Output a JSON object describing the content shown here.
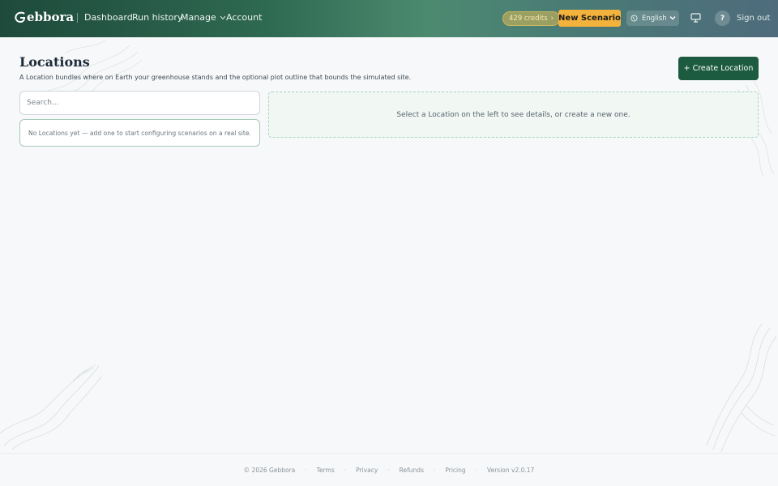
{
  "header": {
    "logo_text": "ebbora",
    "logo_letter": "G",
    "nav": {
      "dashboard": "Dashboard",
      "run_history": "Run history",
      "manage": "Manage",
      "account": "Account"
    },
    "credits": "429 credits",
    "credits_arrow": "›",
    "new_scenario": "New Scenario",
    "language": "English",
    "help": "?",
    "sign_out": "Sign out"
  },
  "main": {
    "title": "Locations",
    "subtitle": "A Location bundles where on Earth your greenhouse stands and the optional plot outline that bounds the simulated site.",
    "create_button": "+ Create Location",
    "search_placeholder": "Search...",
    "empty_message": "No Locations yet — add one to start configuring scenarios on a real site.",
    "detail_placeholder": "Select a Location on the left to see details, or create a new one."
  },
  "footer": {
    "copyright": "© 2026 Gebbora",
    "links": [
      "Terms",
      "Privacy",
      "Refunds",
      "Pricing"
    ],
    "version": "Version v2.0.17"
  },
  "colors": {
    "header_gradient_start": "#1e4a3b",
    "header_gradient_end": "#4e6b7c",
    "accent_yellow": "#f3b23b",
    "primary_green": "#1d5b40",
    "background": "#f7f8f9"
  },
  "icons": [
    "logo-icon",
    "chevron-down-icon",
    "globe-icon",
    "monitor-icon",
    "help-icon"
  ]
}
